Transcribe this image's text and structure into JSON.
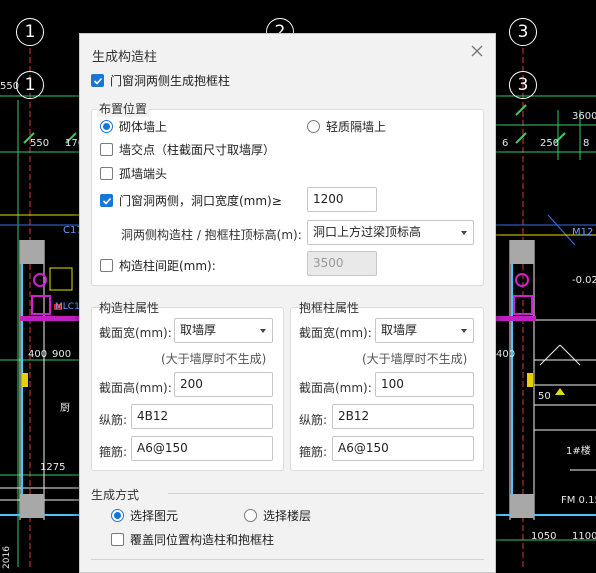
{
  "cad": {
    "axes": [
      "1",
      "2",
      "3",
      "1",
      "3"
    ],
    "labels": {
      "l550a": "550",
      "l550b": "550",
      "l170": "170",
      "l3600": "3600",
      "l250": "250",
      "l6": "6",
      "l8": "8",
      "lC17": "C17",
      "lM12": "M12",
      "lmin002": "-0.02",
      "lMLC": "MLC18",
      "l400a": "400",
      "l900": "900",
      "l400b": "400",
      "l50": "50",
      "l1275": "1275",
      "l1050": "1050",
      "l1100": "1100",
      "lFM": "FM 0.15",
      "lfloor": "1#楼",
      "lchars": "厨",
      "lvert": "2016"
    }
  },
  "dialog": {
    "title": "生成构造柱",
    "top_checkbox": {
      "label": "门窗洞两侧生成抱框柱",
      "checked": true
    },
    "placement": {
      "legend": "布置位置",
      "radio_masonry": {
        "label": "砌体墙上",
        "selected": true
      },
      "radio_light": {
        "label": "轻质隔墙上",
        "selected": false
      },
      "wall_intersection": {
        "label": "墙交点（柱截面尺寸取墙厚）",
        "checked": false
      },
      "wall_end": {
        "label": "孤墙端头",
        "checked": false
      },
      "door_sides": {
        "label": "门窗洞两侧，洞口宽度(mm)≥",
        "checked": true,
        "value": "1200"
      },
      "top_elev": {
        "label": "洞两侧构造柱 / 抱框柱顶标高(m):",
        "value": "洞口上方过梁顶标高"
      },
      "spacing": {
        "label": "构造柱间距(mm):",
        "checked": false,
        "value": "3500"
      }
    },
    "column_props": {
      "title": "构造柱属性",
      "width_label": "截面宽(mm):",
      "width_value": "取墙厚",
      "note": "(大于墙厚时不生成)",
      "height_label": "截面高(mm):",
      "height_value": "200",
      "long_label": "纵筋:",
      "long_value": "4B12",
      "stirrup_label": "箍筋:",
      "stirrup_value": "A6@150"
    },
    "frame_props": {
      "title": "抱框柱属性",
      "width_label": "截面宽(mm):",
      "width_value": "取墙厚",
      "note": "(大于墙厚时不生成)",
      "height_label": "截面高(mm):",
      "height_value": "100",
      "long_label": "纵筋:",
      "long_value": "2B12",
      "stirrup_label": "箍筋:",
      "stirrup_value": "A6@150"
    },
    "generation": {
      "legend": "生成方式",
      "radio_select": {
        "label": "选择图元",
        "selected": true
      },
      "radio_floor": {
        "label": "选择楼层",
        "selected": false
      },
      "overwrite": {
        "label": "覆盖同位置构造柱和抱框柱",
        "checked": false
      }
    }
  }
}
